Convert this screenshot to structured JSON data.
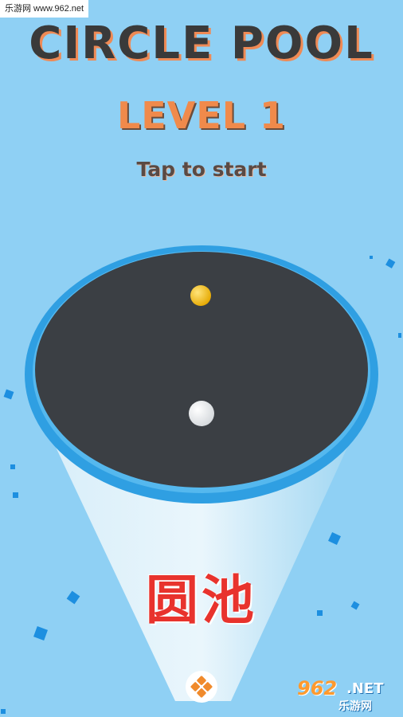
{
  "watermark": {
    "top_text": "乐游网 www.962.net",
    "brand_number": "962",
    "brand_net": ".NET",
    "brand_cn": "乐游网"
  },
  "game": {
    "title": "CIRCLE POOL",
    "level": "LEVEL 1",
    "prompt": "Tap to start"
  },
  "overlay": {
    "cn_title": "圆池"
  },
  "colors": {
    "background": "#8fd0f4",
    "pool_rim": "#2f9fe2",
    "pool_floor": "#3b3f44",
    "ball_yellow": "#f6c21c",
    "ball_white": "#ffffff",
    "title_shadow": "#ef8a55",
    "level_text": "#f08a4b"
  }
}
